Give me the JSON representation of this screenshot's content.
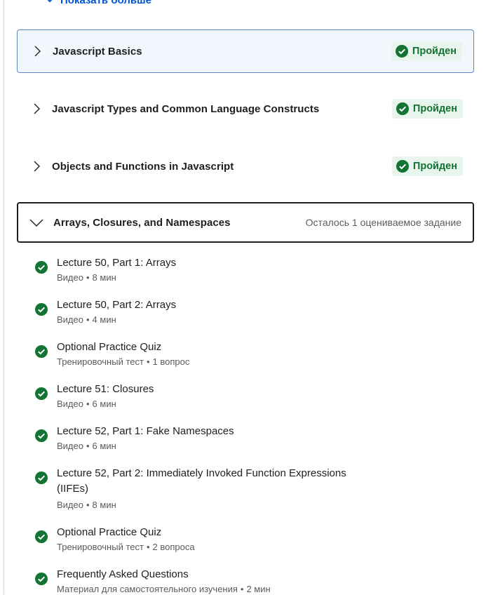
{
  "show_more": {
    "label": "Показать больше"
  },
  "modules": [
    {
      "title": "Javascript Basics",
      "status": "Пройден",
      "state": "selected"
    },
    {
      "title": "Javascript Types and Common Language Constructs",
      "status": "Пройден",
      "state": "collapsed"
    },
    {
      "title": "Objects and Functions in Javascript",
      "status": "Пройден",
      "state": "collapsed"
    },
    {
      "title": "Arrays, Closures, and Namespaces",
      "remaining": "Осталось 1 оцениваемое задание",
      "state": "expanded"
    }
  ],
  "items": [
    {
      "title": "Lecture 50, Part 1: Arrays",
      "type": "Видео",
      "detail": "8 мин"
    },
    {
      "title": "Lecture 50, Part 2: Arrays",
      "type": "Видео",
      "detail": "4 мин"
    },
    {
      "title": "Optional Practice Quiz",
      "type": "Тренировочный тест",
      "detail": "1 вопрос"
    },
    {
      "title": "Lecture 51: Closures",
      "type": "Видео",
      "detail": "6 мин"
    },
    {
      "title": "Lecture 52, Part 1: Fake Namespaces",
      "type": "Видео",
      "detail": "6 мин"
    },
    {
      "title": "Lecture 52, Part 2: Immediately Invoked Function Expressions (IIFEs)",
      "type": "Видео",
      "detail": "8 мин"
    },
    {
      "title": "Optional Practice Quiz",
      "type": "Тренировочный тест",
      "detail": "2 вопроса"
    },
    {
      "title": "Frequently Asked Questions",
      "type": "Материал для самостоятельного изучения",
      "detail": "2 мин"
    }
  ],
  "meta_separator": "•",
  "colors": {
    "accent": "#0056d2",
    "success": "#137333",
    "success_bg": "#e8f5ec",
    "selected_bg": "#f2f7fe"
  },
  "icons": {
    "completed": "check-circle-icon",
    "collapsed": "chevron-right-icon",
    "expanded": "chevron-down-icon"
  }
}
